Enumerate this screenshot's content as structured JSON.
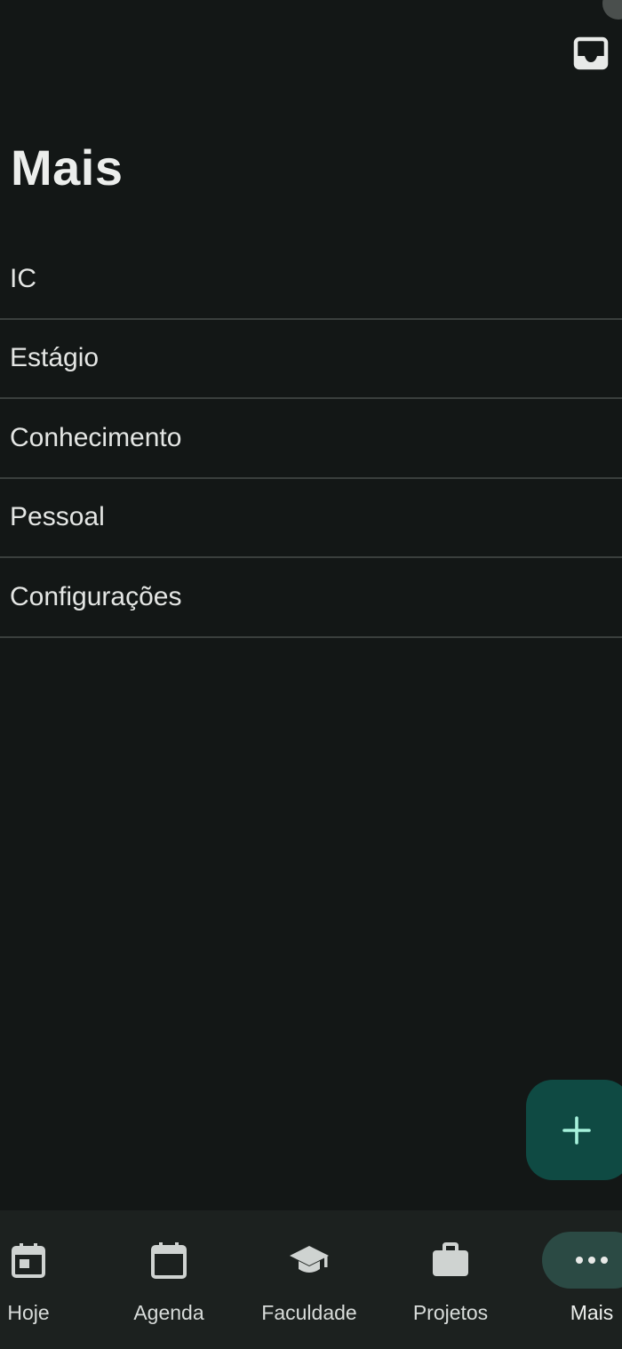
{
  "header": {
    "title": "Mais",
    "inbox_icon": "inbox-icon"
  },
  "menu": {
    "items": [
      {
        "label": "IC"
      },
      {
        "label": "Estágio"
      },
      {
        "label": "Conhecimento"
      },
      {
        "label": "Pessoal"
      },
      {
        "label": "Configurações"
      }
    ]
  },
  "fab": {
    "icon": "plus-icon",
    "color": "#0f4a43"
  },
  "bottom_nav": {
    "active": "Mais",
    "items": [
      {
        "label": "Hoje",
        "icon": "calendar-today-icon"
      },
      {
        "label": "Agenda",
        "icon": "calendar-icon"
      },
      {
        "label": "Faculdade",
        "icon": "graduation-cap-icon"
      },
      {
        "label": "Projetos",
        "icon": "briefcase-icon"
      },
      {
        "label": "Mais",
        "icon": "more-horizontal-icon"
      }
    ]
  },
  "colors": {
    "background": "#131716",
    "nav_background": "#1c211f",
    "active_pill": "#2b4a44",
    "accent": "#9ff0d8"
  }
}
